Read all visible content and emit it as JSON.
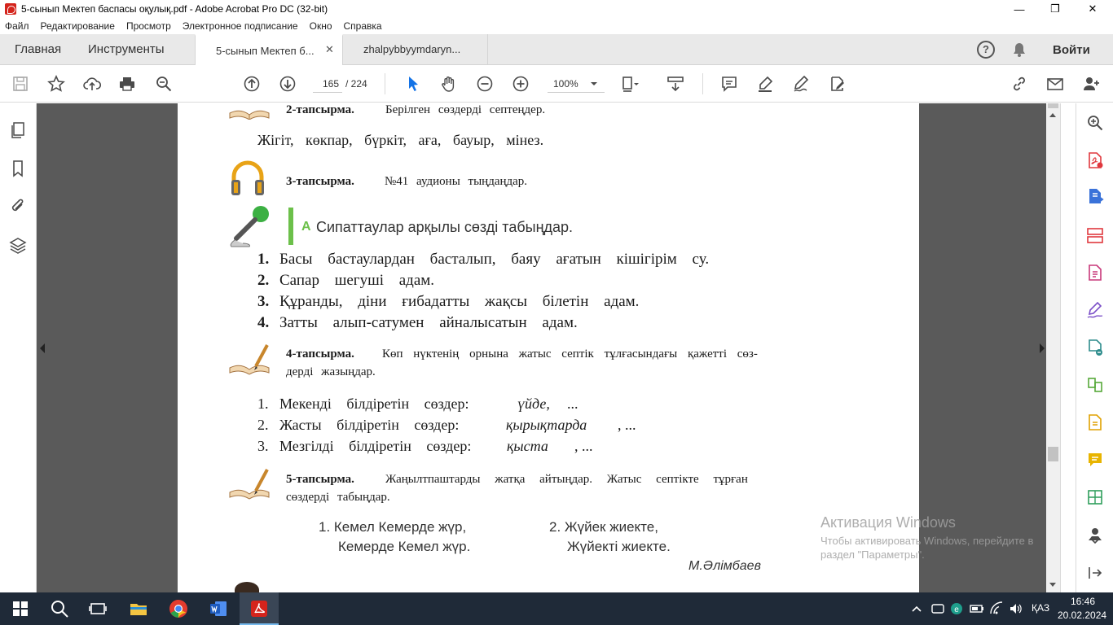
{
  "window": {
    "title": "5-сынып Мектеп баспасы оқулық.pdf - Adobe Acrobat Pro DC (32-bit)",
    "minimize": "—",
    "restore": "❐",
    "close": "✕"
  },
  "menu": [
    "Файл",
    "Редактирование",
    "Просмотр",
    "Электронное подписание",
    "Окно",
    "Справка"
  ],
  "tabs": {
    "home": "Главная",
    "tools": "Инструменты",
    "doc1": "5-сынып Мектеп б...",
    "doc1_close": "✕",
    "doc2": "zhalpybbyymdaryn...",
    "help": "?",
    "signin": "Войти"
  },
  "toolbar": {
    "page_current": "165",
    "page_total": "/ 224",
    "zoom": "100%"
  },
  "document": {
    "ex2_label": "2-тапсырма.",
    "ex2_text": "Берілген сөздерді септеңдер.",
    "ex2_words": "Жігіт, көкпар, бүркіт, аға, бауыр, мінез.",
    "ex3_label": "3-тапсырма.",
    "ex3_text": "№41 аудионы тыңдаңдар.",
    "ta_letter": "А",
    "ta_title": "Сипаттаулар арқылы сөзді табыңдар.",
    "ta_items": [
      {
        "num": "1.",
        "text": "Басы бастаулардан басталып, баяу ағатын кішігірім су."
      },
      {
        "num": "2.",
        "text": "Сапар шегуші адам."
      },
      {
        "num": "3.",
        "text": "Құранды, діни ғибадатты жақсы білетін адам."
      },
      {
        "num": "4.",
        "text": "Затты алып-сатумен айналысатын адам."
      }
    ],
    "ex4_label": "4-тапсырма.",
    "ex4_text_line1": "Көп нүктенің орнына жатыс септік тұлғасындағы қажетті сөз-",
    "ex4_text_line2": "дерді жазыңдар.",
    "ex4_items": [
      {
        "num": "1.",
        "text": "Мекенді білдіретін сөздер:",
        "example": "үйде,",
        "tail": "..."
      },
      {
        "num": "2.",
        "text": "Жасты білдіретін сөздер:",
        "example": "қырықтарда",
        "tail": ", ..."
      },
      {
        "num": "3.",
        "text": "Мезгілді білдіретін сөздер:",
        "example": "қыста",
        "tail": ", ..."
      }
    ],
    "ex5_label": "5-тапсырма.",
    "ex5_text_line1": "Жаңылтпаштарды жатқа айтыңдар. Жатыс септікте тұрған",
    "ex5_text_line2": "сөздерді табыңдар.",
    "tw1_line1": "1. Кемел Кемерде жүр,",
    "tw1_line2": "Кемерде Кемел жүр.",
    "tw2_line1": "2. Жүйек жиекте,",
    "tw2_line2": "Жүйекті жиекте.",
    "author": "М.Әлімбаев"
  },
  "watermark": {
    "title": "Активация Windows",
    "line1": "Чтобы активировать Windows, перейдите в",
    "line2": "раздел \"Параметры\"."
  },
  "taskbar": {
    "lang": "ҚАЗ",
    "time": "16:46",
    "date": "20.02.2024"
  },
  "colors": {
    "acrobat_red": "#d4241c",
    "toolbar_icon": "#4b4b4b",
    "viewer_bg": "#5a5a5a",
    "taskbar_bg": "#1f2a38",
    "accent_blue": "#1473e6",
    "green_bar": "#6cc04a"
  }
}
